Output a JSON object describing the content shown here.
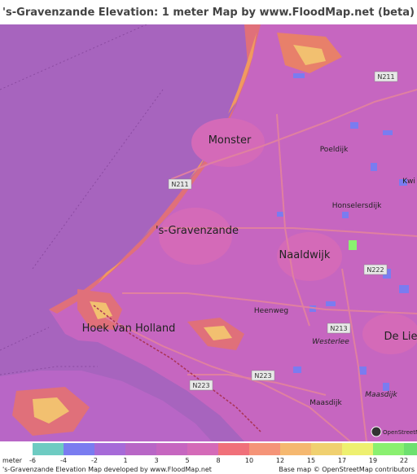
{
  "title": "'s-Gravenzande Elevation: 1 meter Map by www.FloodMap.net (beta)",
  "map": {
    "colors": {
      "sea": "#a764be",
      "land": "#c666c0",
      "low_land": "#b866c6",
      "urban": "#d46ab8",
      "dune_low": "#e0707a",
      "dune_mid": "#f09a60",
      "dune_high": "#f6d070",
      "water_blue": "#7a7cf0",
      "roads": "#e080a0",
      "motorway": "#aa3355"
    },
    "places": [
      {
        "name": "Monster",
        "size": "large"
      },
      {
        "name": "Poeldijk",
        "size": "small"
      },
      {
        "name": "Honselersdijk",
        "size": "small"
      },
      {
        "name": "'s-Gravenzande",
        "size": "large"
      },
      {
        "name": "Naaldwijk",
        "size": "large"
      },
      {
        "name": "Heenweg",
        "size": "small"
      },
      {
        "name": "Hoek van Holland",
        "size": "large"
      },
      {
        "name": "De Lie",
        "size": "large"
      },
      {
        "name": "Westerlee",
        "size": "small-italic"
      },
      {
        "name": "Maasdijk",
        "size": "small"
      },
      {
        "name": "Maasdijk",
        "size": "small-italic"
      },
      {
        "name": "Kwi",
        "size": "small"
      }
    ],
    "roads": [
      "N211",
      "N211",
      "N222",
      "N213",
      "N223",
      "N223"
    ],
    "attribution_overlay": "OpenStreetMap"
  },
  "legend": {
    "unit": "meter",
    "ticks": [
      "-6",
      "-4",
      "-2",
      "1",
      "3",
      "5",
      "8",
      "10",
      "12",
      "15",
      "17",
      "19",
      "22"
    ],
    "colors": [
      "#6ecbc2",
      "#7a7cf0",
      "#a66ad8",
      "#b866c6",
      "#c666c0",
      "#d46ab8",
      "#f0707a",
      "#f59478",
      "#f5b870",
      "#f0d070",
      "#eef070",
      "#8af070",
      "#6ee070"
    ]
  },
  "footer": {
    "left": "'s-Gravenzande Elevation Map developed by www.FloodMap.net",
    "right": "Base map © OpenStreetMap contributors"
  }
}
